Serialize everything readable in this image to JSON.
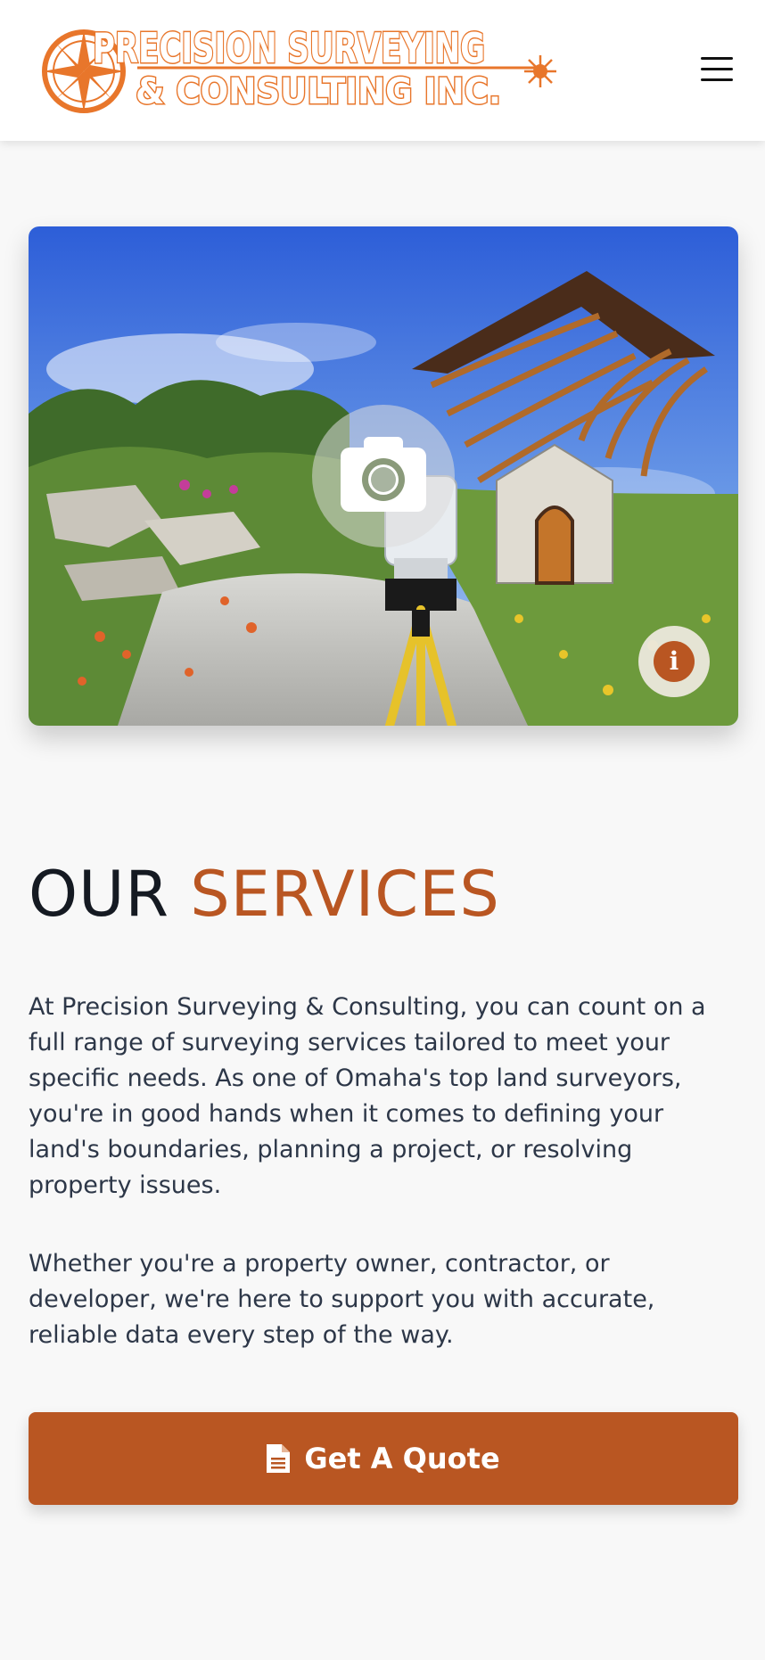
{
  "header": {
    "logo_line1": "PRECISION SURVEYING",
    "logo_line2": "& CONSULTING INC.",
    "menu_icon": "hamburger-icon"
  },
  "hero": {
    "camera_icon": "camera-icon",
    "info_icon": "info-icon",
    "info_glyph": "i"
  },
  "services": {
    "title_dark": "OUR",
    "title_accent": "SERVICES",
    "paragraph1": "At Precision Surveying & Consulting, you can count on a full range of surveying services tailored to meet your specific needs. As one of Omaha's top land surveyors, you're in good hands when it comes to defining your land's boundaries, planning a project, or resolving property issues.",
    "paragraph2": "Whether you're a property owner, contractor, or developer, we're here to support you with accurate, reliable data every step of the way.",
    "cta_label": "Get A Quote",
    "cta_icon": "document-icon"
  },
  "colors": {
    "accent": "#b95622",
    "logo_orange": "#e8762b",
    "heading_dark": "#151a22",
    "body_text": "#2d3748",
    "background": "#f8f8f8"
  }
}
